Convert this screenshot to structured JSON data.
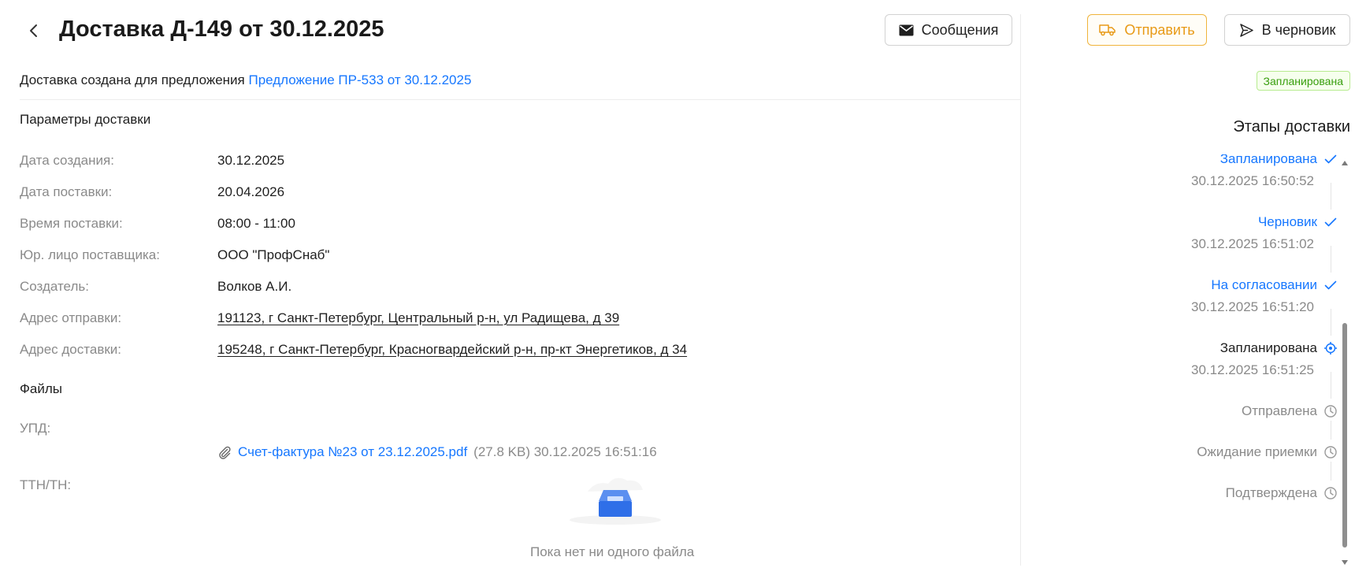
{
  "header": {
    "title": "Доставка Д-149 от 30.12.2025",
    "messages_label": "Сообщения",
    "send_label": "Отправить",
    "draft_label": "В черновик"
  },
  "origin": {
    "prefix": "Доставка создана для предложения",
    "link": "Предложение ПР-533 от 30.12.2025"
  },
  "params": {
    "title": "Параметры доставки",
    "rows": [
      {
        "label": "Дата создания:",
        "value": "30.12.2025"
      },
      {
        "label": "Дата поставки:",
        "value": "20.04.2026"
      },
      {
        "label": "Время поставки:",
        "value": "08:00 - 11:00"
      },
      {
        "label": "Юр. лицо поставщика:",
        "value": "ООО \"ПрофСнаб\""
      },
      {
        "label": "Создатель:",
        "value": "Волков А.И."
      },
      {
        "label": "Адрес отправки:",
        "value": "191123, г Санкт-Петербург, Центральный р-н, ул Радищева, д 39"
      },
      {
        "label": "Адрес доставки:",
        "value": "195248, г Санкт-Петербург, Красногвардейский р-н, пр-кт Энергетиков, д 34"
      }
    ]
  },
  "files": {
    "title": "Файлы",
    "upd_label": "УПД:",
    "upd_file": {
      "name": "Счет-фактура №23 от 23.12.2025.pdf",
      "meta": "(27.8 KB) 30.12.2025 16:51:16"
    },
    "ttn_label": "ТТН/ТН:",
    "empty_text": "Пока нет ни одного файла"
  },
  "status": {
    "badge": "Запланирована",
    "badge_colors": {
      "bg": "#f6ffed",
      "border": "#b7eb8f",
      "text": "#389e0d"
    }
  },
  "steps": {
    "title": "Этапы доставки",
    "items": [
      {
        "name": "Запланирована",
        "time": "30.12.2025 16:50:52",
        "state": "done",
        "icon": "check-icon"
      },
      {
        "name": "Черновик",
        "time": "30.12.2025 16:51:02",
        "state": "done",
        "icon": "check-icon"
      },
      {
        "name": "На согласовании",
        "time": "30.12.2025 16:51:20",
        "state": "done",
        "icon": "check-icon"
      },
      {
        "name": "Запланирована",
        "time": "30.12.2025 16:51:25",
        "state": "current",
        "icon": "target-icon"
      },
      {
        "name": "Отправлена",
        "time": "",
        "state": "pending",
        "icon": "clock-icon"
      },
      {
        "name": "Ожидание приемки",
        "time": "",
        "state": "pending",
        "icon": "clock-icon"
      },
      {
        "name": "Подтверждена",
        "time": "",
        "state": "pending",
        "icon": "clock-icon"
      }
    ]
  },
  "colors": {
    "accent": "#1677ff",
    "send": "#e89a17",
    "muted": "#8a8a8a"
  }
}
